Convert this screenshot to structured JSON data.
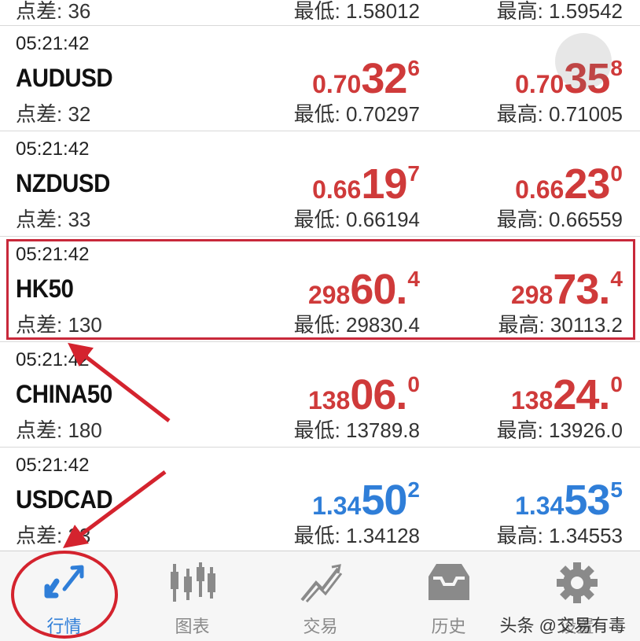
{
  "colors": {
    "up": "#cf3a3a",
    "down": "#2f7ed8",
    "accent": "#2f7ed8",
    "annotation": "#d4232e"
  },
  "partial_row": {
    "spread": "点差: 36",
    "low": "最低: 1.58012",
    "high": "最高: 1.59542"
  },
  "rows": [
    {
      "time": "05:21:42",
      "symbol": "AUDUSD",
      "spread": "点差: 32",
      "bid": {
        "pre": "0.70",
        "big": "32",
        "sup": "6"
      },
      "ask": {
        "pre": "0.70",
        "big": "35",
        "sup": "8"
      },
      "low": "最低: 0.70297",
      "high": "最高: 0.71005",
      "color": "up"
    },
    {
      "time": "05:21:42",
      "symbol": "NZDUSD",
      "spread": "点差: 33",
      "bid": {
        "pre": "0.66",
        "big": "19",
        "sup": "7"
      },
      "ask": {
        "pre": "0.66",
        "big": "23",
        "sup": "0"
      },
      "low": "最低: 0.66194",
      "high": "最高: 0.66559",
      "color": "up"
    },
    {
      "time": "05:21:42",
      "symbol": "HK50",
      "spread": "点差: 130",
      "bid": {
        "pre": "298",
        "big": "60.",
        "sup": "4"
      },
      "ask": {
        "pre": "298",
        "big": "73.",
        "sup": "4"
      },
      "low": "最低: 29830.4",
      "high": "最高: 30113.2",
      "color": "up"
    },
    {
      "time": "05:21:42",
      "symbol": "CHINA50",
      "spread": "点差: 180",
      "bid": {
        "pre": "138",
        "big": "06.",
        "sup": "0"
      },
      "ask": {
        "pre": "138",
        "big": "24.",
        "sup": "0"
      },
      "low": "最低: 13789.8",
      "high": "最高: 13926.0",
      "color": "up"
    },
    {
      "time": "05:21:42",
      "symbol": "USDCAD",
      "spread": "点差: 23",
      "bid": {
        "pre": "1.34",
        "big": "50",
        "sup": "2"
      },
      "ask": {
        "pre": "1.34",
        "big": "53",
        "sup": "5"
      },
      "low": "最低: 1.34128",
      "high": "最高: 1.34553",
      "color": "down"
    }
  ],
  "tabs": [
    {
      "label": "行情",
      "icon": "quotes-arrows-icon",
      "active": true
    },
    {
      "label": "图表",
      "icon": "candlestick-chart-icon",
      "active": false
    },
    {
      "label": "交易",
      "icon": "trade-trend-icon",
      "active": false
    },
    {
      "label": "历史",
      "icon": "history-inbox-icon",
      "active": false
    },
    {
      "label": "设置",
      "icon": "gear-icon",
      "active": false
    }
  ],
  "watermark": "头条 @交易有毒"
}
